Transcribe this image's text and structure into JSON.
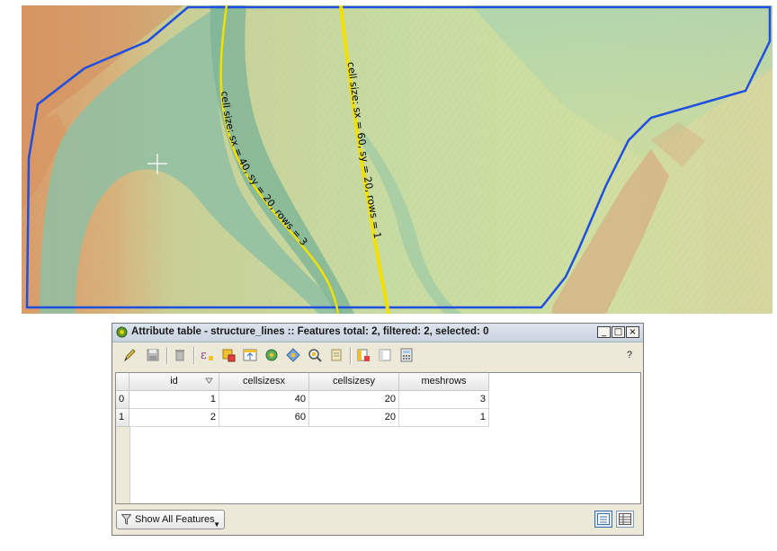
{
  "map": {
    "line_labels": [
      "cell size: sx = 40, sy = 20, rows = 3",
      "cell size: sx = 60, sy = 20, rows = 1"
    ],
    "colors": {
      "polygon_outline": "#1f4fe0",
      "structure_line": "#f2e000"
    }
  },
  "window": {
    "title": "Attribute table - structure_lines :: Features total: 2, filtered: 2, selected: 0",
    "min_label": "_",
    "max_label": "□",
    "close_label": "×",
    "help_label": "?"
  },
  "toolbar_icons": [
    "toggle-editing-icon",
    "save-edits-icon",
    "delete-selected-icon",
    "select-by-expression-icon",
    "unselect-all-icon",
    "move-selection-to-top-icon",
    "invert-selection-icon",
    "pan-map-to-selection-icon",
    "zoom-map-to-selection-icon",
    "copy-selected-rows-icon",
    "delete-column-icon",
    "new-column-icon",
    "field-calculator-icon"
  ],
  "table": {
    "columns": [
      "id",
      "cellsizesx",
      "cellsizesy",
      "meshrows"
    ],
    "rows": [
      {
        "row_header": "0",
        "cells": [
          "1",
          "40",
          "20",
          "3"
        ]
      },
      {
        "row_header": "1",
        "cells": [
          "2",
          "60",
          "20",
          "1"
        ]
      }
    ]
  },
  "footer": {
    "filter_button_label": "Show All Features"
  }
}
